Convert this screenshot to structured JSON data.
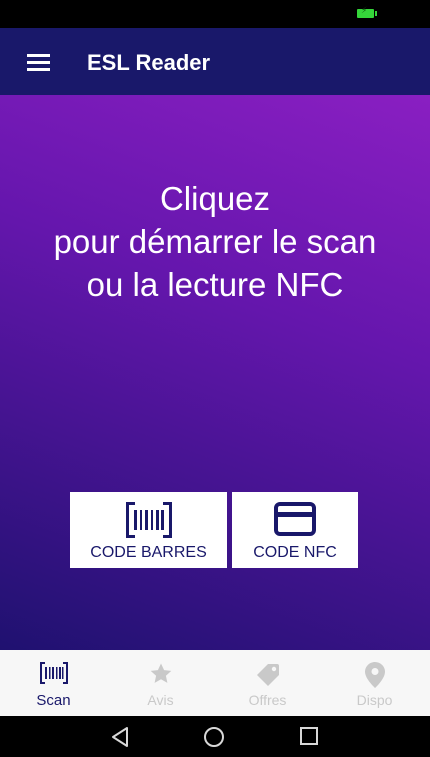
{
  "app_bar": {
    "title": "ESL Reader",
    "menu_icon": "hamburger-menu-icon"
  },
  "prompt": {
    "lines": [
      "Cliquez",
      "pour démarrer le scan",
      "ou la lecture NFC"
    ]
  },
  "buttons": {
    "barcode": {
      "label": "CODE BARRES",
      "icon": "barcode-icon"
    },
    "nfc": {
      "label": "CODE NFC",
      "icon": "card-icon"
    }
  },
  "bottom_nav": {
    "items": [
      {
        "label": "Scan",
        "icon": "barcode-icon",
        "active": true
      },
      {
        "label": "Avis",
        "icon": "star-icon",
        "active": false
      },
      {
        "label": "Offres",
        "icon": "tag-icon",
        "active": false
      },
      {
        "label": "Dispo",
        "icon": "location-pin-icon",
        "active": false
      }
    ]
  },
  "colors": {
    "primary_dark": "#19186a",
    "gradient_top": "#8a1fc2",
    "gradient_bottom": "#1f1170",
    "nav_inactive": "#c9c9c9",
    "battery": "#35d63a"
  },
  "system_nav": {
    "icons": [
      "back-icon",
      "home-icon",
      "recents-icon"
    ]
  }
}
